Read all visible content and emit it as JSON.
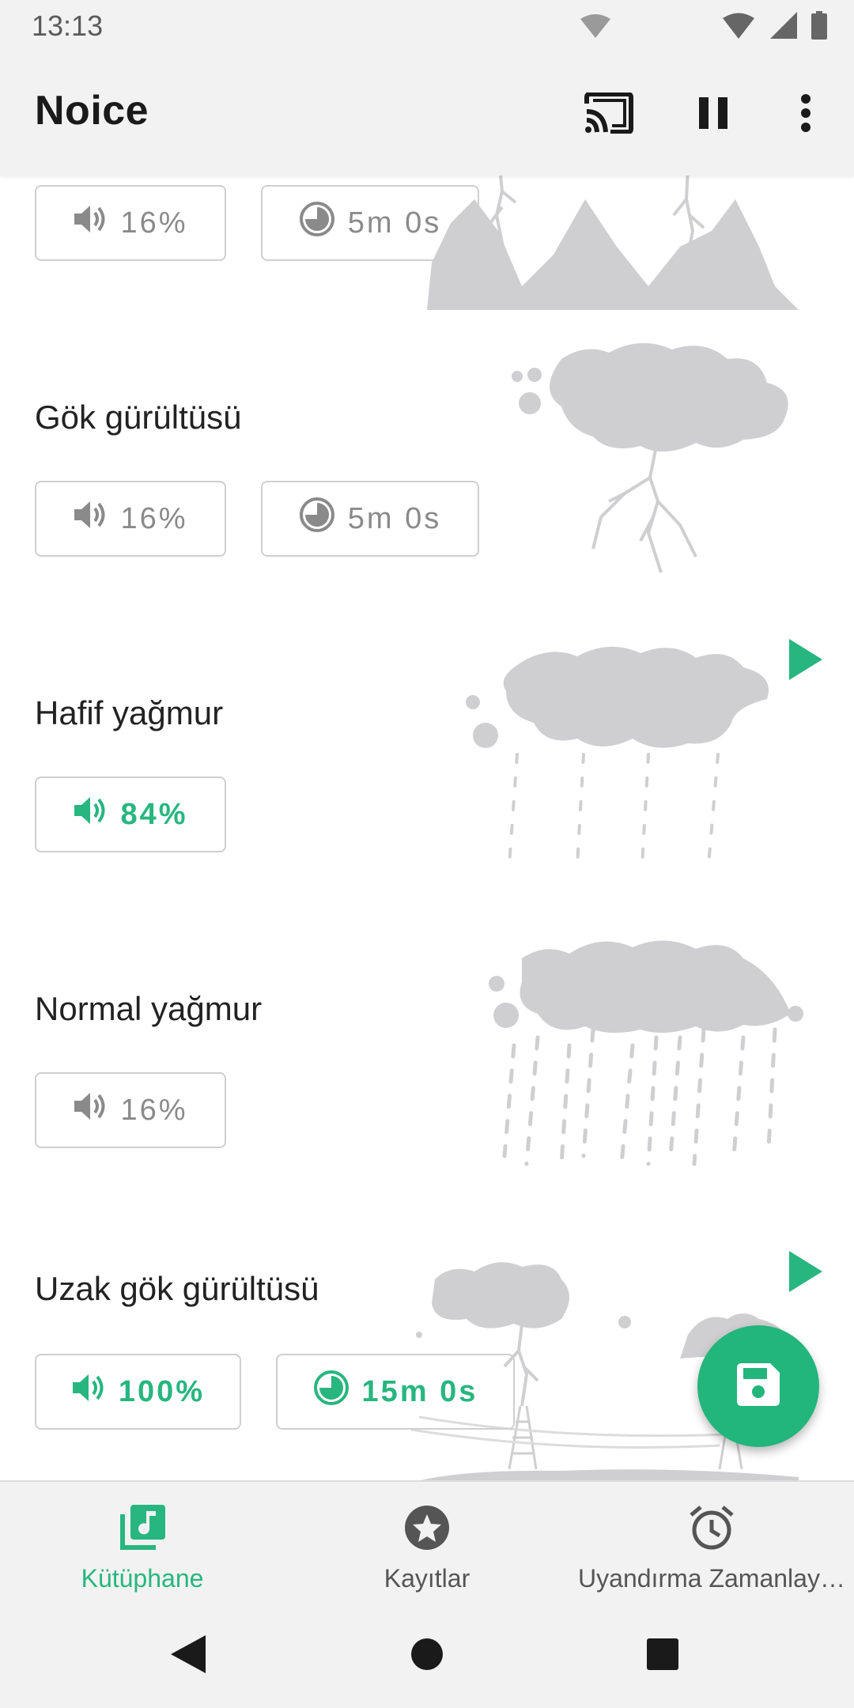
{
  "status_bar": {
    "time": "13:13"
  },
  "app_bar": {
    "title": "Noice",
    "actions": [
      "cast-icon",
      "pause-icon",
      "more-vert-icon"
    ]
  },
  "colors": {
    "accent": "#27b67f",
    "fab": "#22b57c",
    "art": "#cfcfd1"
  },
  "sounds": [
    {
      "name": "",
      "volume": "16%",
      "timer": "5m 0s",
      "active": false,
      "playing": false
    },
    {
      "name": "Gök gürültüsü",
      "volume": "16%",
      "timer": "5m 0s",
      "active": false,
      "playing": false
    },
    {
      "name": "Hafif yağmur",
      "volume": "84%",
      "timer": "",
      "active": true,
      "playing": true
    },
    {
      "name": "Normal yağmur",
      "volume": "16%",
      "timer": "",
      "active": false,
      "playing": false
    },
    {
      "name": "Uzak gök gürültüsü",
      "volume": "100%",
      "timer": "15m 0s",
      "active": true,
      "playing": true
    }
  ],
  "fab": {
    "icon": "save-icon"
  },
  "bottom_nav": {
    "items": [
      {
        "label": "Kütüphane",
        "icon": "library-music-icon",
        "active": true
      },
      {
        "label": "Kayıtlar",
        "icon": "star-icon",
        "active": false
      },
      {
        "label": "Uyandırma Zamanlay…",
        "icon": "alarm-icon",
        "active": false
      }
    ]
  },
  "system_nav": [
    "back-icon",
    "home-icon",
    "recents-icon"
  ]
}
